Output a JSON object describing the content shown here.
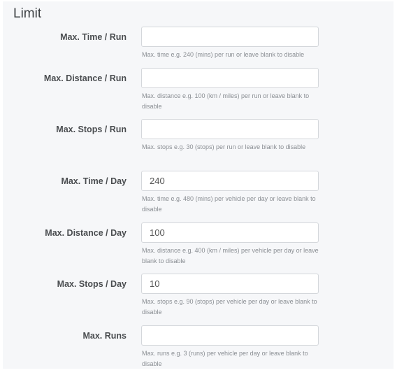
{
  "section": {
    "title": "Limit"
  },
  "fields": [
    {
      "label": "Max. Time / Run",
      "value": "",
      "help": "Max. time e.g. 240 (mins) per run or leave blank to disable"
    },
    {
      "label": "Max. Distance / Run",
      "value": "",
      "help": "Max. distance e.g. 100 (km / miles) per run or leave blank to disable"
    },
    {
      "label": "Max. Stops / Run",
      "value": "",
      "help": "Max. stops e.g. 30 (stops) per run or leave blank to disable"
    },
    {
      "label": "Max. Time / Day",
      "value": "240",
      "help": "Max. time e.g. 480 (mins) per vehicle per day or leave blank to disable"
    },
    {
      "label": "Max. Distance / Day",
      "value": "100",
      "help": "Max. distance e.g. 400 (km / miles) per vehicle per day or leave blank to disable"
    },
    {
      "label": "Max. Stops / Day",
      "value": "10",
      "help": "Max. stops e.g. 90 (stops) per vehicle per day or leave blank to disable"
    },
    {
      "label": "Max. Runs",
      "value": "",
      "help": "Max. runs e.g. 3 (runs) per vehicle per day or leave blank to disable"
    }
  ]
}
